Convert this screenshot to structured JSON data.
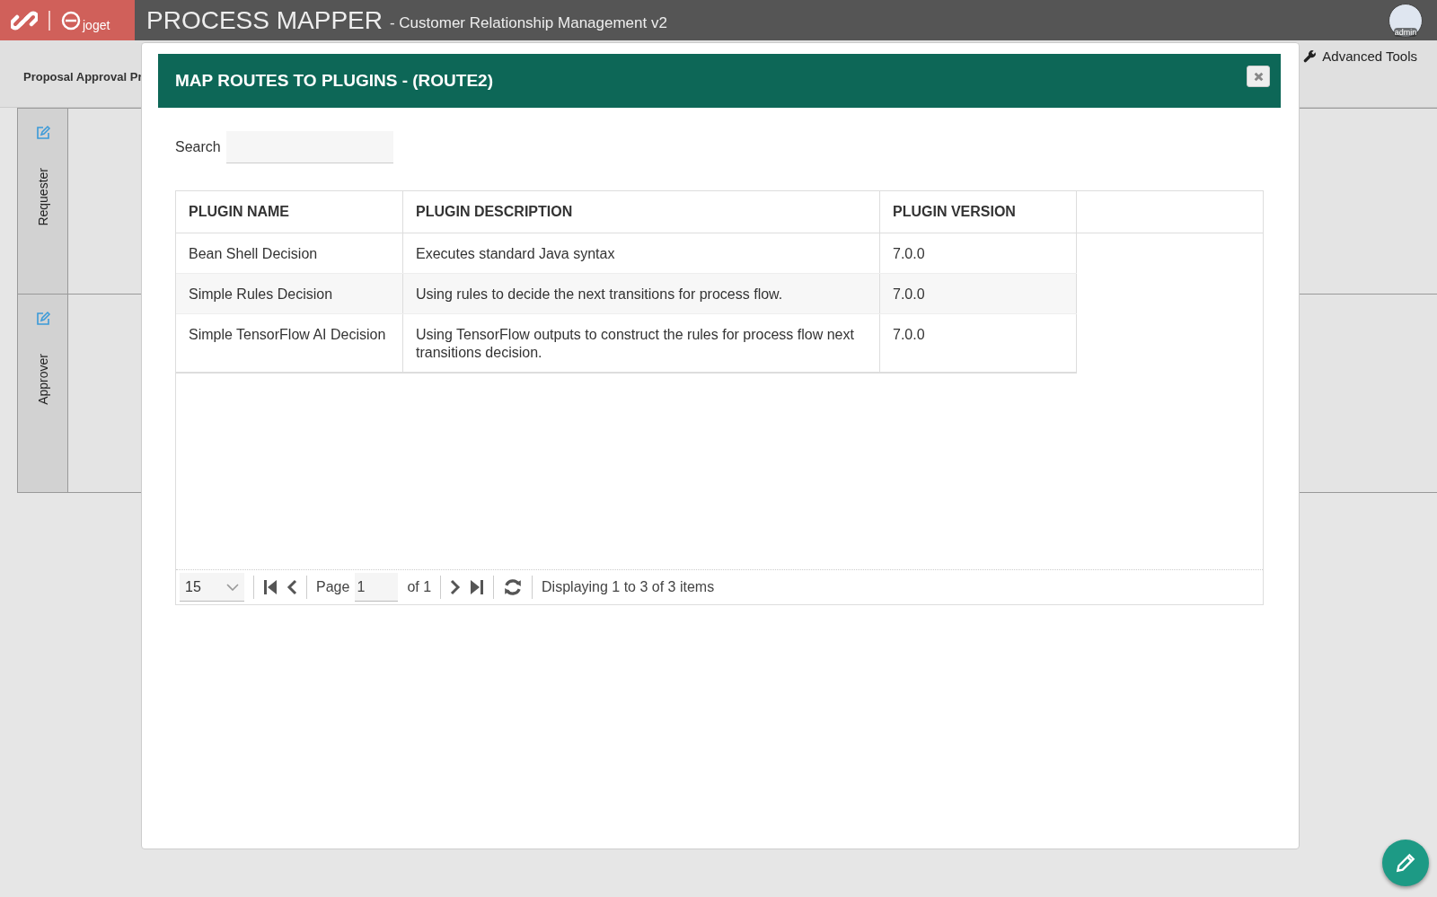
{
  "header": {
    "logo_text": "joget",
    "title": "PROCESS MAPPER",
    "subtitle": "- Customer Relationship Management v2",
    "user": "admin"
  },
  "process_tab": "Proposal Approval Pr",
  "advanced_tools": "Advanced Tools",
  "lanes": [
    "Requester",
    "Approver"
  ],
  "dialog": {
    "title": "MAP ROUTES TO PLUGINS - (ROUTE2)",
    "search_label": "Search",
    "columns": [
      "PLUGIN NAME",
      "PLUGIN DESCRIPTION",
      "PLUGIN VERSION"
    ],
    "rows": [
      {
        "name": "Bean Shell Decision",
        "description": "Executes standard Java syntax",
        "version": "7.0.0"
      },
      {
        "name": "Simple Rules Decision",
        "description": "Using rules to decide the next transitions for process flow.",
        "version": "7.0.0"
      },
      {
        "name": "Simple TensorFlow AI Decision",
        "description": "Using TensorFlow outputs to construct the rules for process flow next transitions decision.",
        "version": "7.0.0"
      }
    ],
    "pager": {
      "page_size": "15",
      "page_label": "Page",
      "page": "1",
      "of": "of 1",
      "display": "Displaying 1 to 3 of 3 items"
    }
  }
}
